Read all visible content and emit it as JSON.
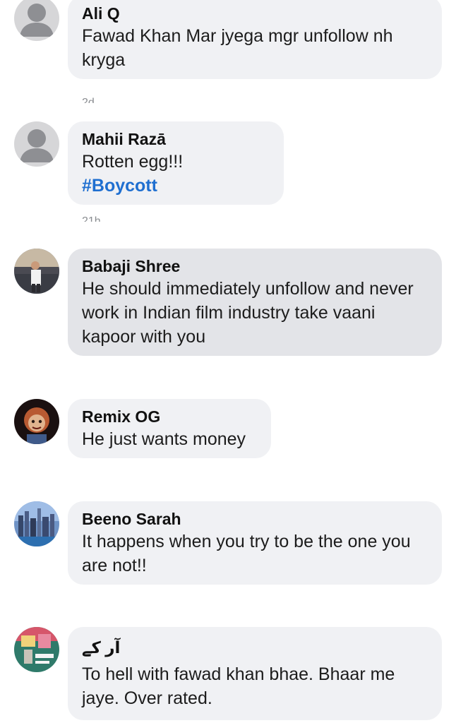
{
  "comments": [
    {
      "author": "Ali Q",
      "text": "Fawad Khan Mar jyega mgr unfollow nh kryga",
      "avatar": "default-avatar",
      "meta": "2d"
    },
    {
      "author": "Mahii Razā",
      "text": "Rotten egg!!!",
      "hashtag": "#Boycott",
      "avatar": "default-avatar",
      "meta": "21h"
    },
    {
      "author": "Babaji Shree",
      "text": "He should immediately unfollow and never work in Indian film industry take vaani kapoor with you",
      "avatar": "photo-avatar-man-standing"
    },
    {
      "author": "Remix OG",
      "text": "He just wants money",
      "avatar": "photo-avatar-doll"
    },
    {
      "author": "Beeno Sarah",
      "text": "It happens when you try to be the one you are not!!",
      "avatar": "photo-avatar-city"
    },
    {
      "author": "آر کے",
      "text": "To hell with fawad khan bhae. Bhaar me jaye. Over rated.",
      "avatar": "photo-avatar-poster"
    }
  ],
  "colors": {
    "bubble": "#f0f1f4",
    "bubble_highlighted": "#e3e4e8",
    "hashtag": "#1f6fd0",
    "meta": "#8a8d91"
  }
}
